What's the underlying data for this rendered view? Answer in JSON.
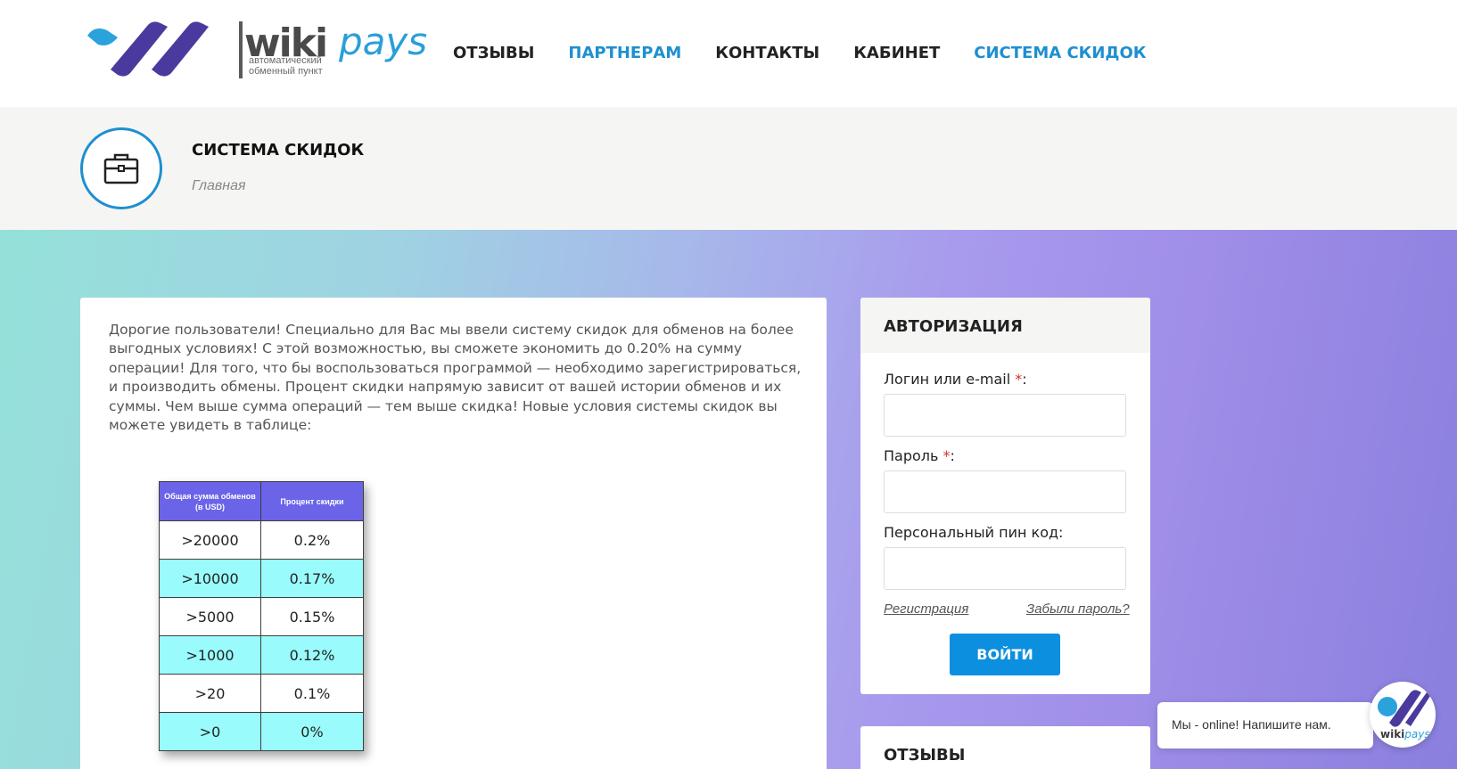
{
  "header": {
    "logo": {
      "word_wiki": "wiki",
      "word_pays": "pays",
      "sub1": "автоматический",
      "sub2": "обменный пункт"
    },
    "nav": [
      {
        "label": "ОТЗЫВЫ",
        "active": false
      },
      {
        "label": "ПАРТНЕРАМ",
        "active": true
      },
      {
        "label": "КОНТАКТЫ",
        "active": false
      },
      {
        "label": "КАБИНЕТ",
        "active": false
      },
      {
        "label": "СИСТЕМА СКИДОК",
        "active": true
      }
    ]
  },
  "title_band": {
    "icon": "briefcase-icon",
    "title": "СИСТЕМА СКИДОК",
    "breadcrumb": "Главная"
  },
  "main": {
    "intro": "Дорогие пользователи! Специально для Вас мы ввели систему скидок для обменов на более выгодных условиях! С этой возможностью, вы сможете экономить до 0.20% на сумму операции! Для того, что бы воспользоваться программой — необходимо зарегистрироваться, и производить обмены. Процент скидки напрямую зависит от вашей истории обменов и их суммы. Чем выше сумма операций — тем выше скидка! Новые условия системы скидок вы можете увидеть в таблице:",
    "table": {
      "headers": [
        "Общая сумма обменов (в USD)",
        "Процент скидки"
      ],
      "rows": [
        [
          ">20000",
          "0.2%"
        ],
        [
          ">10000",
          "0.17%"
        ],
        [
          ">5000",
          "0.15%"
        ],
        [
          ">1000",
          "0.12%"
        ],
        [
          ">20",
          "0.1%"
        ],
        [
          ">0",
          "0%"
        ]
      ]
    }
  },
  "auth": {
    "title": "АВТОРИЗАЦИЯ",
    "login_label": "Логин или e-mail",
    "password_label": "Пароль",
    "pin_label": "Персональный пин код:",
    "required_mark": "*",
    "colon": ":",
    "register_link": "Регистрация",
    "forgot_link": "Забыли пароль?",
    "login_button": "ВОЙТИ"
  },
  "reviews": {
    "title": "ОТЗЫВЫ"
  },
  "chat": {
    "message": "Мы - online! Напишите нам.",
    "avatar_word_wiki": "wiki",
    "avatar_word_pays": "pays"
  },
  "colors": {
    "accent": "#1e8fd0",
    "button": "#0d8fe0",
    "table_header": "#6b63e8",
    "table_alt_row": "#99fbfb",
    "required": "#e02b2b"
  }
}
